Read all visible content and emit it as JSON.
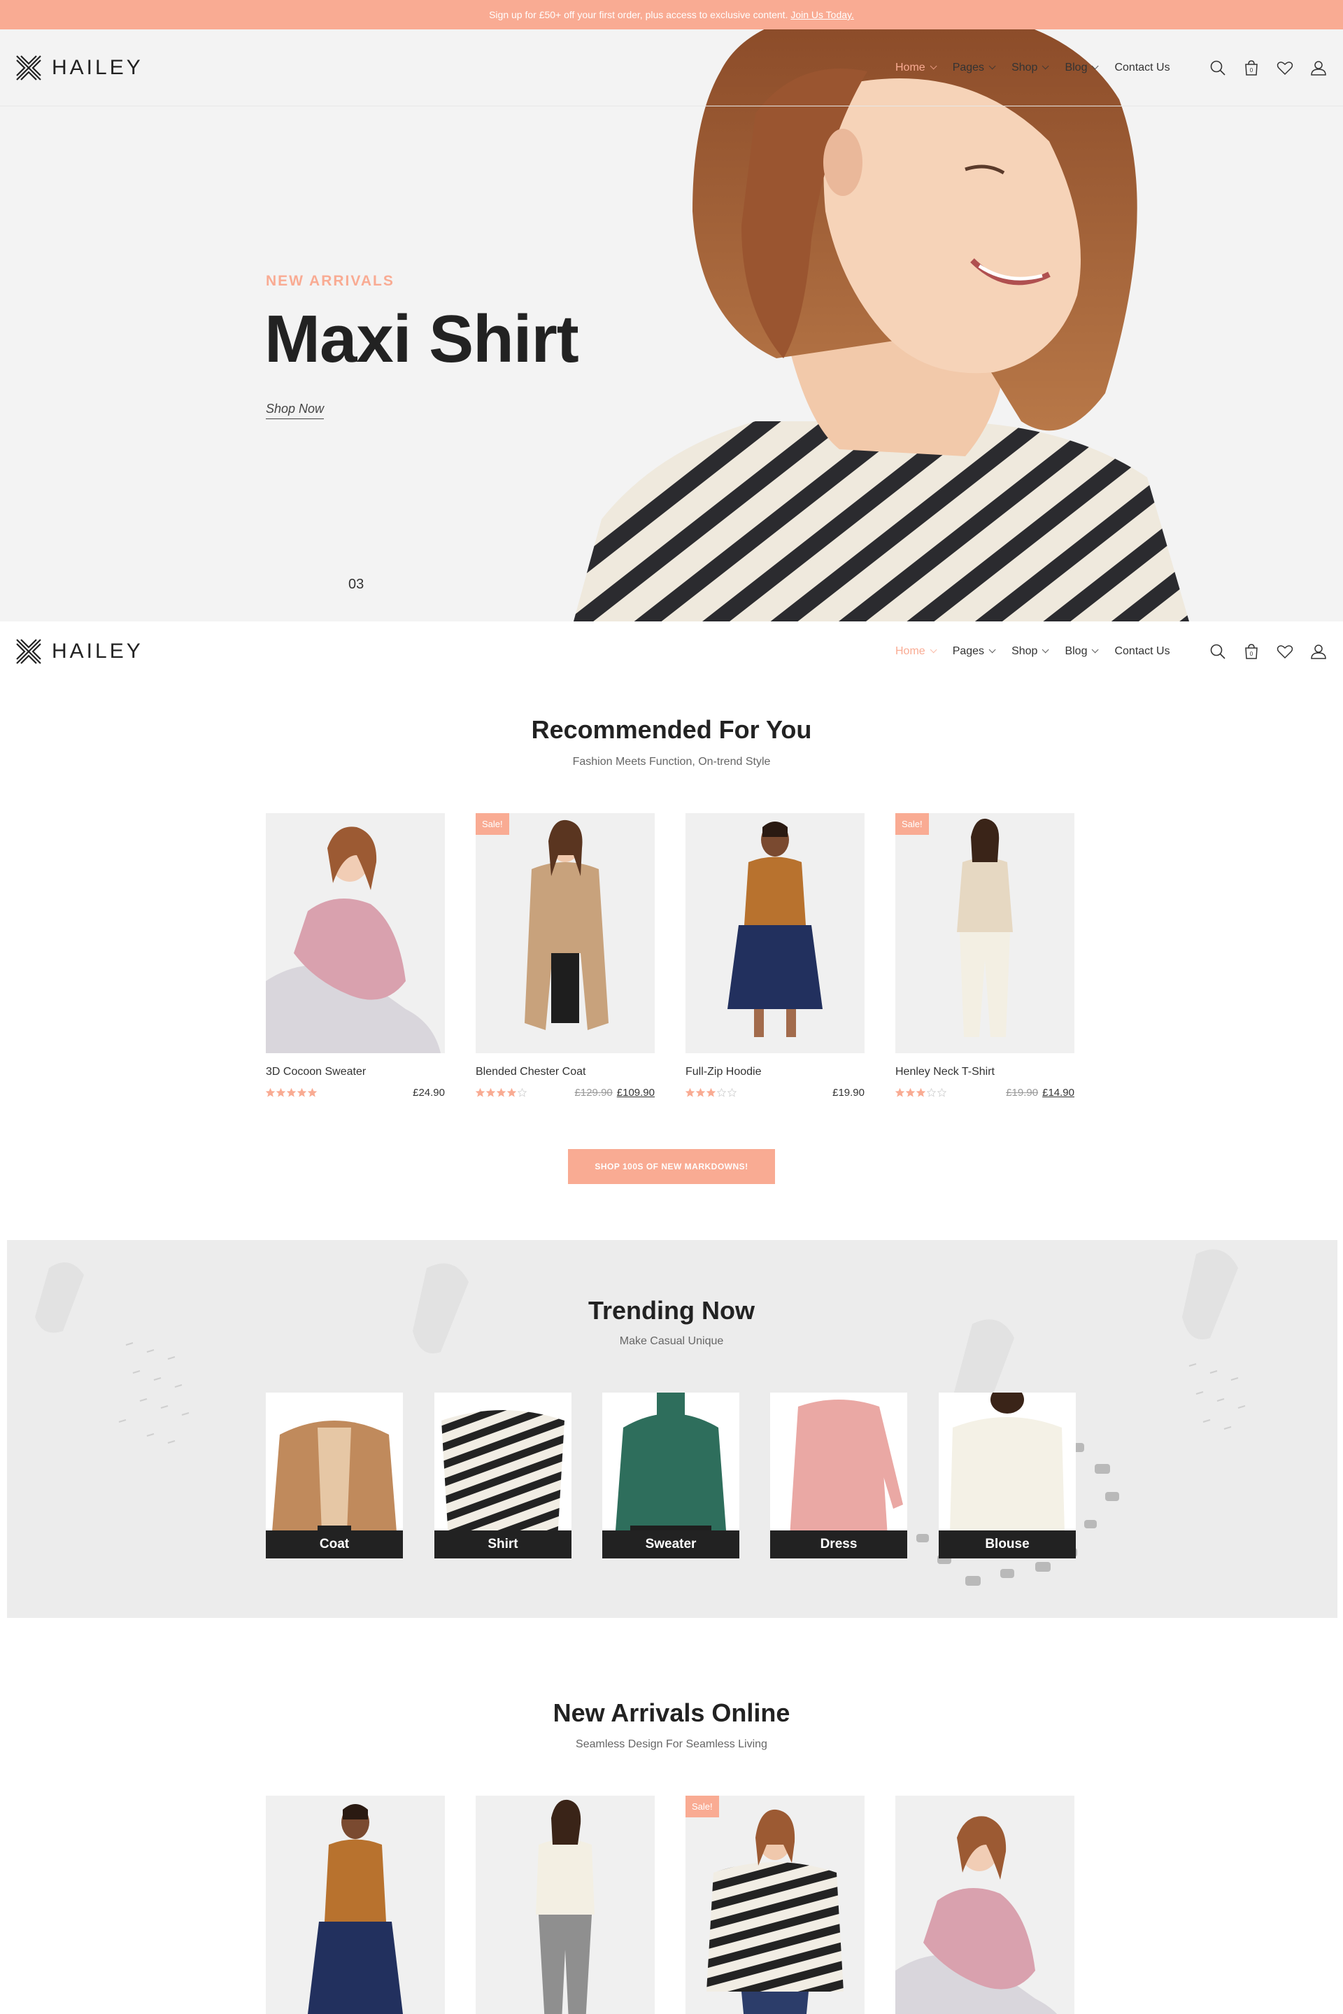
{
  "announcement": {
    "text": "Sign up for £50+ off your first order, plus access to exclusive content.",
    "link": "Join Us Today."
  },
  "brand": {
    "name": "HAILEY"
  },
  "nav": [
    {
      "label": "Home",
      "active": true
    },
    {
      "label": "Pages",
      "active": false
    },
    {
      "label": "Shop",
      "active": false
    },
    {
      "label": "Blog",
      "active": false
    },
    {
      "label": "Contact Us",
      "active": false
    }
  ],
  "cart_count": "0",
  "hero": {
    "subtitle": "NEW ARRIVALS",
    "title": "Maxi Shirt",
    "link": "Shop Now",
    "counter": "03"
  },
  "recommended": {
    "title": "Recommended For You",
    "subtitle": "Fashion Meets Function, On-trend Style",
    "products": [
      {
        "name": "3D Cocoon Sweater",
        "price": "£24.90",
        "old_price": "",
        "rating": 5,
        "sale": ""
      },
      {
        "name": "Blended Chester Coat",
        "price": "£109.90",
        "old_price": "£129.90",
        "rating": 4,
        "sale": "Sale!"
      },
      {
        "name": "Full-Zip Hoodie",
        "price": "£19.90",
        "old_price": "",
        "rating": 3,
        "sale": ""
      },
      {
        "name": "Henley Neck T-Shirt",
        "price": "£14.90",
        "old_price": "£19.90",
        "rating": 3,
        "sale": "Sale!"
      }
    ],
    "cta": "SHOP 100S OF NEW MARKDOWNS!"
  },
  "trending": {
    "title": "Trending Now",
    "subtitle": "Make Casual Unique",
    "categories": [
      "Coat",
      "Shirt",
      "Sweater",
      "Dress",
      "Blouse"
    ]
  },
  "arrivals": {
    "title": "New Arrivals Online",
    "subtitle": "Seamless Design For Seamless Living",
    "sale_label": "Sale!"
  },
  "colors": {
    "accent": "#f9ab93",
    "dark": "#222222",
    "bg_light": "#f3f3f3"
  }
}
